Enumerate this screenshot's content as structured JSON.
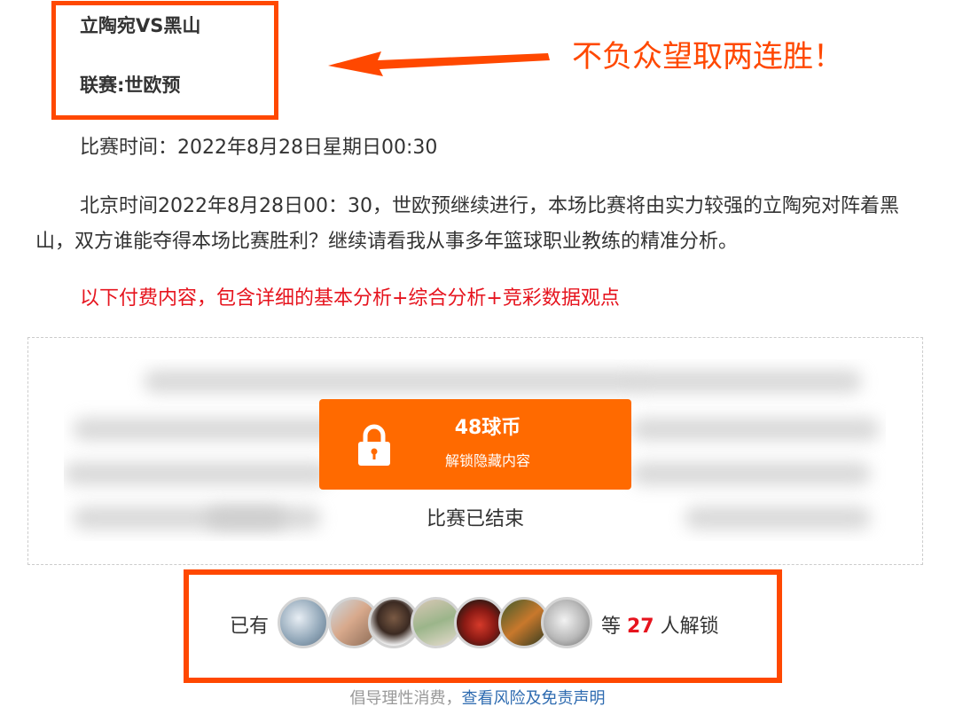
{
  "header": {
    "match_title": "立陶宛VS黑山",
    "league": "联赛:世欧预",
    "callout": "不负众望取两连胜！"
  },
  "article": {
    "time_label": "比赛时间：2022年8月28日星期日00:30",
    "paragraph": "北京时间2022年8月28日00：30，世欧预继续进行，本场比赛将由实力较强的立陶宛对阵着黑山，双方谁能夺得本场比赛胜利？继续请看我从事多年篮球职业教练的精准分析。",
    "paid_note": "以下付费内容，包含详细的基本分析+综合分析+竞彩数据观点"
  },
  "paywall": {
    "price": "48球币",
    "unlock_label": "解锁隐藏内容",
    "status": "比赛已结束"
  },
  "unlocked": {
    "prefix": "已有",
    "etc_prefix": "等 ",
    "count": "27",
    "suffix": " 人解锁"
  },
  "footer": {
    "text": "倡导理性消费，",
    "link": "查看风险及免责声明"
  },
  "colors": {
    "accent": "#ff4800",
    "button": "#ff6a00",
    "red_text": "#e6141e",
    "link": "#2e6bb0"
  }
}
